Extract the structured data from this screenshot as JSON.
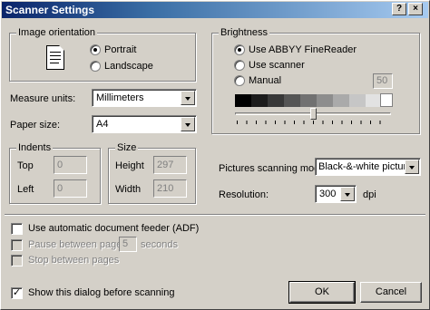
{
  "window": {
    "title": "Scanner Settings",
    "help_label": "?",
    "close_label": "×"
  },
  "orientation": {
    "group_label": "Image orientation",
    "options": [
      {
        "label": "Portrait",
        "selected": true
      },
      {
        "label": "Landscape",
        "selected": false
      }
    ]
  },
  "measure_units": {
    "label": "Measure units:",
    "value": "Millimeters"
  },
  "paper_size": {
    "label": "Paper size:",
    "value": "A4"
  },
  "indents": {
    "group_label": "Indents",
    "top_label": "Top",
    "top_value": "0",
    "left_label": "Left",
    "left_value": "0"
  },
  "size": {
    "group_label": "Size",
    "height_label": "Height",
    "height_value": "297",
    "width_label": "Width",
    "width_value": "210"
  },
  "brightness": {
    "group_label": "Brightness",
    "options": [
      {
        "label": "Use ABBYY FineReader",
        "selected": true
      },
      {
        "label": "Use scanner",
        "selected": false
      },
      {
        "label": "Manual",
        "selected": false
      }
    ],
    "manual_value": "50",
    "slider_value": 50,
    "swatch_colors": [
      "#000000",
      "#1c1c1c",
      "#383838",
      "#555555",
      "#717171",
      "#8d8d8d",
      "#aaaaaa",
      "#c6c6c6",
      "#e2e2e2"
    ]
  },
  "scanning_mode": {
    "label": "Pictures scanning mode:",
    "value": "Black-&-white pictures"
  },
  "resolution": {
    "label": "Resolution:",
    "value": "300",
    "unit": "dpi"
  },
  "options": {
    "adf_label": "Use automatic document feeder (ADF)",
    "adf_checked": false,
    "pause_label": "Pause between pages",
    "pause_value": "5",
    "pause_unit": "seconds",
    "stop_label": "Stop between pages",
    "show_dialog_label": "Show this dialog before scanning",
    "show_dialog_checked": true
  },
  "buttons": {
    "ok": "OK",
    "cancel": "Cancel"
  }
}
